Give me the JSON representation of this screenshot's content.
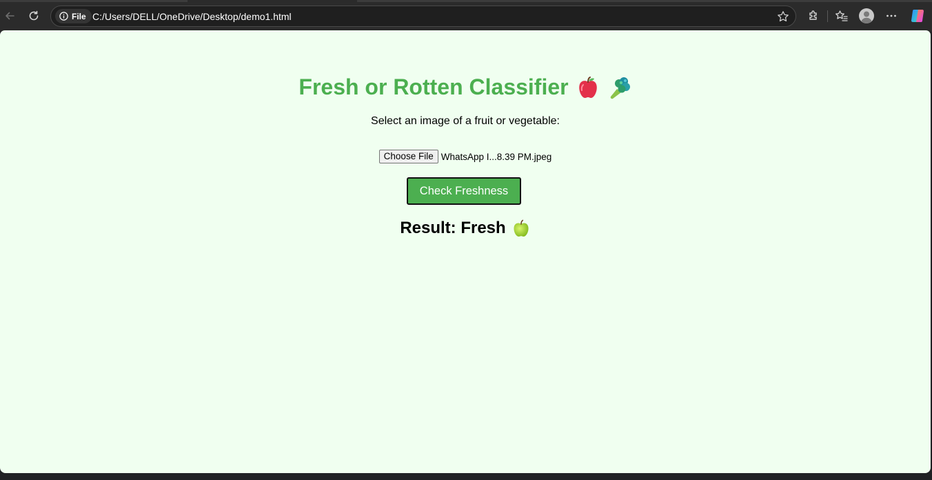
{
  "browser": {
    "site_chip_label": "File",
    "url": "C:/Users/DELL/OneDrive/Desktop/demo1.html",
    "icons": [
      "back-icon",
      "reload-icon",
      "info-icon",
      "star-icon",
      "extensions-icon",
      "favorites-icon",
      "profile-icon",
      "more-icon",
      "copilot-icon"
    ]
  },
  "page": {
    "title": "Fresh or Rotten Classifier",
    "title_emojis": [
      "red-apple-icon",
      "broccoli-icon"
    ],
    "prompt": "Select an image of a fruit or vegetable:",
    "file_input": {
      "button_label": "Choose File",
      "file_name": "WhatsApp I...8.39 PM.jpeg"
    },
    "check_button_label": "Check Freshness",
    "result_text": "Result: Fresh",
    "result_emoji": "green-apple-icon"
  },
  "colors": {
    "page_background": "#f0fff0",
    "title_green": "#4caf50",
    "button_green": "#4caf50",
    "browser_chrome": "#2b2b2b"
  }
}
